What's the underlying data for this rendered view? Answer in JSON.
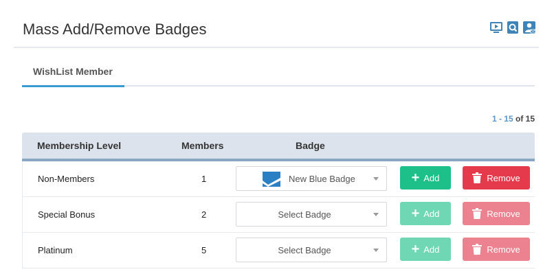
{
  "header": {
    "title": "Mass Add/Remove Badges",
    "icons": [
      "video-icon",
      "search-doc-icon",
      "user-mail-icon"
    ]
  },
  "tabs": [
    {
      "label": "WishList Member",
      "active": true
    }
  ],
  "pagination": {
    "start": "1",
    "separator": " - ",
    "end": "15",
    "of_label": " of 15"
  },
  "table": {
    "columns": [
      "Membership Level",
      "Members",
      "Badge"
    ],
    "rows": [
      {
        "level": "Non-Members",
        "members": "1",
        "badge": "New Blue Badge",
        "has_logo": true,
        "add_label": "Add",
        "remove_label": "Remove",
        "enabled": true
      },
      {
        "level": "Special Bonus",
        "members": "2",
        "badge": "Select Badge",
        "has_logo": false,
        "add_label": "Add",
        "remove_label": "Remove",
        "enabled": false
      },
      {
        "level": "Platinum",
        "members": "5",
        "badge": "Select Badge",
        "has_logo": false,
        "add_label": "Add",
        "remove_label": "Remove",
        "enabled": false
      }
    ]
  },
  "colors": {
    "accent": "#3a9bd1",
    "add": "#1ec08a",
    "remove": "#e53a4b",
    "header_icon": "#3f84b8"
  }
}
